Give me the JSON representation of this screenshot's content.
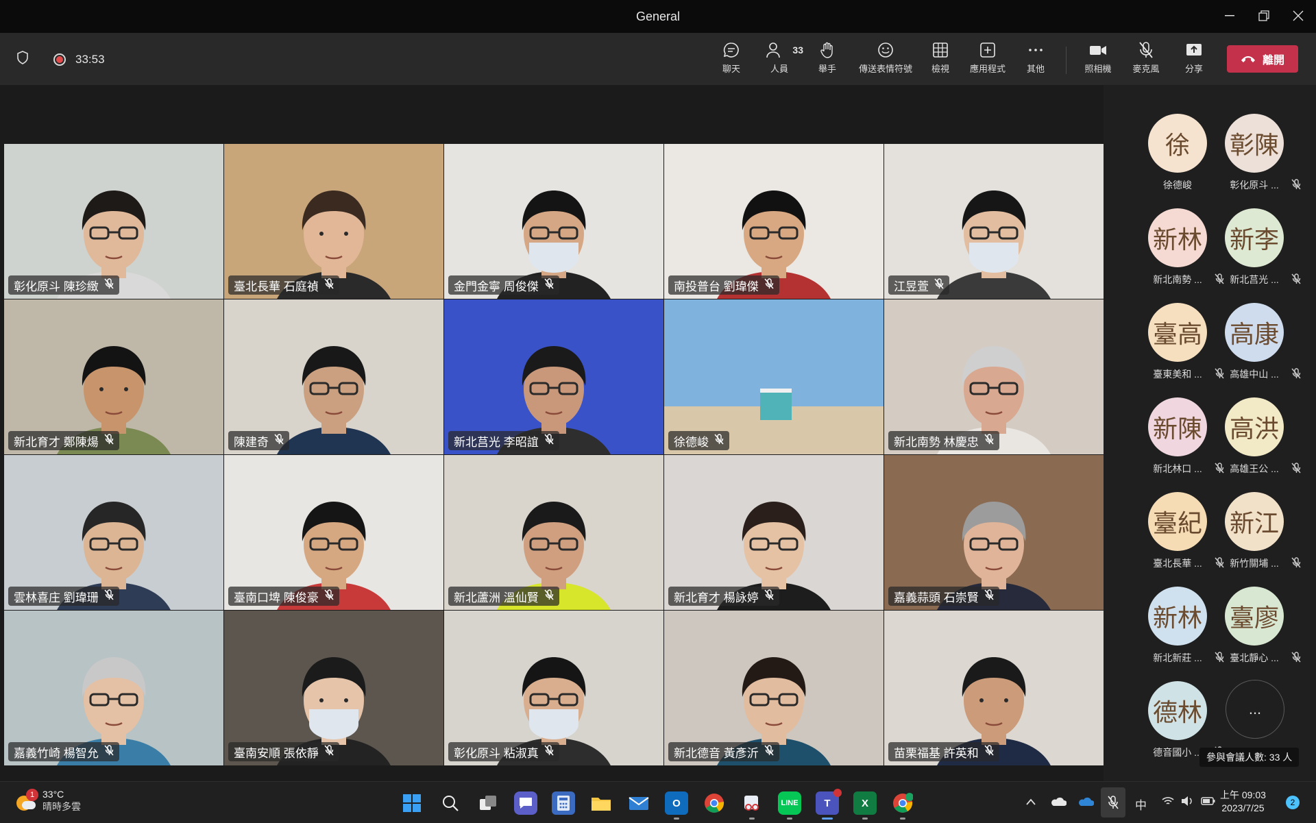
{
  "window": {
    "title": "General"
  },
  "meeting": {
    "timer": "33:53",
    "people_count": "33"
  },
  "toolbar": [
    {
      "key": "chat",
      "label": "聊天"
    },
    {
      "key": "people",
      "label": "人員"
    },
    {
      "key": "raise",
      "label": "舉手"
    },
    {
      "key": "react",
      "label": "傳送表情符號"
    },
    {
      "key": "view",
      "label": "檢視"
    },
    {
      "key": "apps",
      "label": "應用程式"
    },
    {
      "key": "more",
      "label": "其他"
    },
    {
      "key": "camera",
      "label": "照相機"
    },
    {
      "key": "mic",
      "label": "麥克風"
    },
    {
      "key": "share",
      "label": "分享"
    }
  ],
  "leave_label": "離開",
  "tiles": [
    {
      "name": "彰化原斗 陳珍緻",
      "wall": "#cfd3cf",
      "shirt": "#d9d9d9",
      "skin": "#e0b89a",
      "hair": "#1e1a18",
      "mask": false,
      "glasses": true
    },
    {
      "name": "臺北長華 石庭禎",
      "wall": "#c9a57a",
      "shirt": "#2a2a2a",
      "skin": "#e2b797",
      "hair": "#3a2a20",
      "mask": false,
      "glasses": false
    },
    {
      "name": "金門金寧 周俊傑",
      "wall": "#e6e4e1",
      "shirt": "#222222",
      "skin": "#d6a784",
      "hair": "#141414",
      "mask": true,
      "glasses": true
    },
    {
      "name": "南投普台 劉瑋傑",
      "wall": "#ebe8e4",
      "shirt": "#b43232",
      "skin": "#d8a882",
      "hair": "#111111",
      "mask": false,
      "glasses": true
    },
    {
      "name": "江昱萱",
      "wall": "#e4e1dc",
      "shirt": "#3a3a3a",
      "skin": "#e3bd9f",
      "hair": "#161616",
      "mask": true,
      "glasses": true
    },
    {
      "name": "新北育才 鄭陳煬",
      "wall": "#bfb7a8",
      "shirt": "#7b8a52",
      "skin": "#c8946c",
      "hair": "#131313",
      "mask": false,
      "glasses": false
    },
    {
      "name": "陳建奇",
      "wall": "#d8d3cb",
      "shirt": "#1f3552",
      "skin": "#caa080",
      "hair": "#181818",
      "mask": false,
      "glasses": true
    },
    {
      "name": "新北莒光 李昭誼",
      "wall": "#3a52c8",
      "shirt": "#2e2e2e",
      "skin": "#c9987a",
      "hair": "#1a1a1a",
      "mask": false,
      "glasses": true
    },
    {
      "name": "徐德峻",
      "wall": "#7fb2dc",
      "shirt": "",
      "skin": "",
      "hair": "",
      "mask": false,
      "glasses": false
    },
    {
      "name": "新北南勢 林慶忠",
      "wall": "#d4cbc3",
      "shirt": "#e9e6e1",
      "skin": "#d9a891",
      "hair": "#cfcfcf",
      "mask": false,
      "glasses": true
    },
    {
      "name": "雲林喜庄 劉瑋珊",
      "wall": "#c7cdd1",
      "shirt": "#2f3c55",
      "skin": "#dcb595",
      "hair": "#262626",
      "mask": false,
      "glasses": true
    },
    {
      "name": "臺南口埤 陳俊豪",
      "wall": "#e8e6e2",
      "shirt": "#c83a3a",
      "skin": "#d6a882",
      "hair": "#151515",
      "mask": false,
      "glasses": true
    },
    {
      "name": "新北蘆洲 溫仙賢",
      "wall": "#d9d4cc",
      "shirt": "#d7e62a",
      "skin": "#cf9f80",
      "hair": "#1a1a1a",
      "mask": false,
      "glasses": true
    },
    {
      "name": "新北育才 楊詠婷",
      "wall": "#d9d6d4",
      "shirt": "#1d1d1d",
      "skin": "#e6c2a4",
      "hair": "#2a1f1a",
      "mask": false,
      "glasses": true
    },
    {
      "name": "嘉義蒜頭 石崇賢",
      "wall": "#8b6a52",
      "shirt": "#262a3a",
      "skin": "#e0b498",
      "hair": "#9c9c9c",
      "mask": false,
      "glasses": true
    },
    {
      "name": "嘉義竹崎 楊智允",
      "wall": "#b7c3c4",
      "shirt": "#3a7ea8",
      "skin": "#e4c0a4",
      "hair": "#c8c8c8",
      "mask": false,
      "glasses": true
    },
    {
      "name": "臺南安順 張依靜",
      "wall": "#5d564e",
      "shirt": "#232323",
      "skin": "#e6c4aa",
      "hair": "#1b1b1b",
      "mask": true,
      "glasses": false
    },
    {
      "name": "彰化原斗 粘淑真",
      "wall": "#d7d4ce",
      "shirt": "#2d2d2d",
      "skin": "#d8ae8e",
      "hair": "#151515",
      "mask": true,
      "glasses": true
    },
    {
      "name": "新北德音 黃彥沂",
      "wall": "#cdc7bf",
      "shirt": "#1e4f6b",
      "skin": "#e2bc9f",
      "hair": "#231a16",
      "mask": false,
      "glasses": true
    },
    {
      "name": "苗栗福基 許英和",
      "wall": "#dcd8d1",
      "shirt": "#1f2a44",
      "skin": "#cc9b7a",
      "hair": "#1a1a1a",
      "mask": false,
      "glasses": false
    }
  ],
  "roster": [
    {
      "initials": "徐",
      "name": "徐德峻",
      "color": "#f5e3cf",
      "muted": false
    },
    {
      "initials": "彰陳",
      "name": "彰化原斗 ...",
      "color": "#ece0d8",
      "muted": true
    },
    {
      "initials": "新林",
      "name": "新北南勢 ...",
      "color": "#f5d9d3",
      "muted": true
    },
    {
      "initials": "新李",
      "name": "新北莒光 ...",
      "color": "#dde9d2",
      "muted": true
    },
    {
      "initials": "臺高",
      "name": "臺東美和 ...",
      "color": "#f6dfbf",
      "muted": true
    },
    {
      "initials": "高康",
      "name": "高雄中山 ...",
      "color": "#cfdcee",
      "muted": true
    },
    {
      "initials": "新陳",
      "name": "新北林口 ...",
      "color": "#efd6df",
      "muted": true
    },
    {
      "initials": "高洪",
      "name": "高雄王公 ...",
      "color": "#f2e9c6",
      "muted": true
    },
    {
      "initials": "臺紀",
      "name": "臺北長華 ...",
      "color": "#f5dcb5",
      "muted": true
    },
    {
      "initials": "新江",
      "name": "新竹關埔 ...",
      "color": "#f1e1c9",
      "muted": true
    },
    {
      "initials": "新林",
      "name": "新北新莊 ...",
      "color": "#cfe1ee",
      "muted": true
    },
    {
      "initials": "臺廖",
      "name": "臺北靜心 ...",
      "color": "#d8e7d2",
      "muted": true
    },
    {
      "initials": "德林",
      "name": "德音國小 ...",
      "color": "#cfe3e6",
      "muted": true
    }
  ],
  "roster_more": "...",
  "participants_count_label": "參與會議人數: 33 人",
  "taskbar": {
    "weather_temp": "33°C",
    "weather_desc": "晴時多雲",
    "weather_badge": "1",
    "ime": "中",
    "time": "上午 09:03",
    "date": "2023/7/25",
    "notif_count": "2"
  }
}
